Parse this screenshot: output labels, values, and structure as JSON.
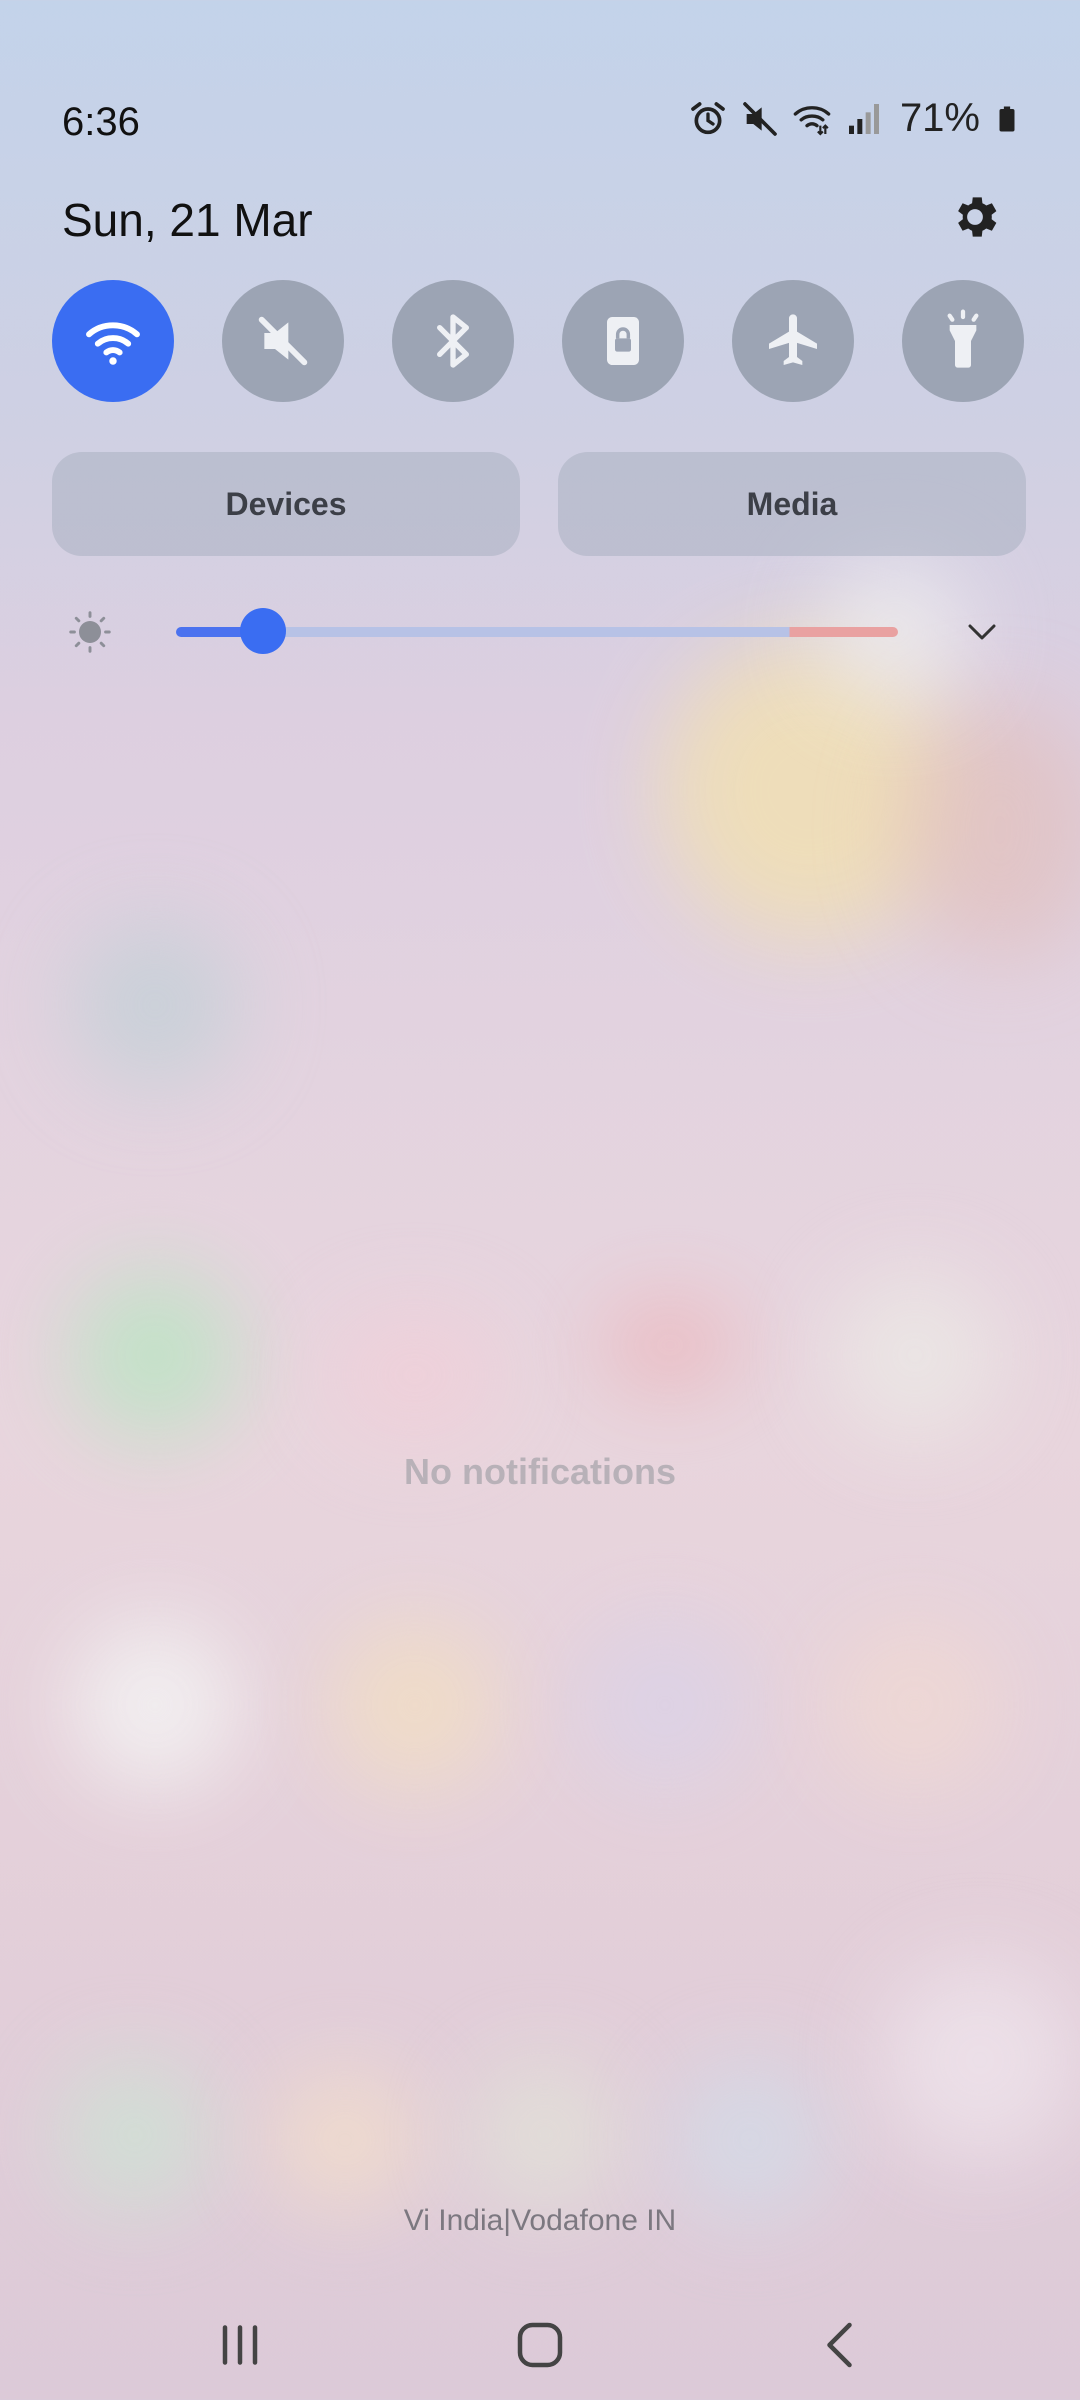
{
  "status_bar": {
    "time": "6:36",
    "battery_percent": "71%",
    "icons": [
      "alarm-icon",
      "mute-icon",
      "wifi-icon",
      "signal-icon",
      "battery-icon"
    ]
  },
  "header": {
    "date": "Sun, 21 Mar",
    "settings_icon": "gear-icon"
  },
  "quick_toggles": [
    {
      "name": "Wi-Fi",
      "icon": "wifi-icon",
      "active": true
    },
    {
      "name": "Mute",
      "icon": "mute-icon",
      "active": false
    },
    {
      "name": "Bluetooth",
      "icon": "bluetooth-icon",
      "active": false
    },
    {
      "name": "Portrait lock",
      "icon": "rotation-lock-icon",
      "active": false
    },
    {
      "name": "Airplane mode",
      "icon": "airplane-icon",
      "active": false
    },
    {
      "name": "Flashlight",
      "icon": "flashlight-icon",
      "active": false
    }
  ],
  "panels": {
    "devices_label": "Devices",
    "media_label": "Media"
  },
  "brightness": {
    "level": 0.12,
    "icon": "brightness-icon",
    "expand_icon": "chevron-down-icon"
  },
  "notifications": {
    "empty_text": "No notifications"
  },
  "carrier": "Vi India|Vodafone IN",
  "nav_bar": {
    "icons": [
      "recents-icon",
      "home-icon",
      "back-icon"
    ]
  },
  "colors": {
    "accent": "#3a6df2",
    "toggle_off": "#9ca4b4"
  }
}
